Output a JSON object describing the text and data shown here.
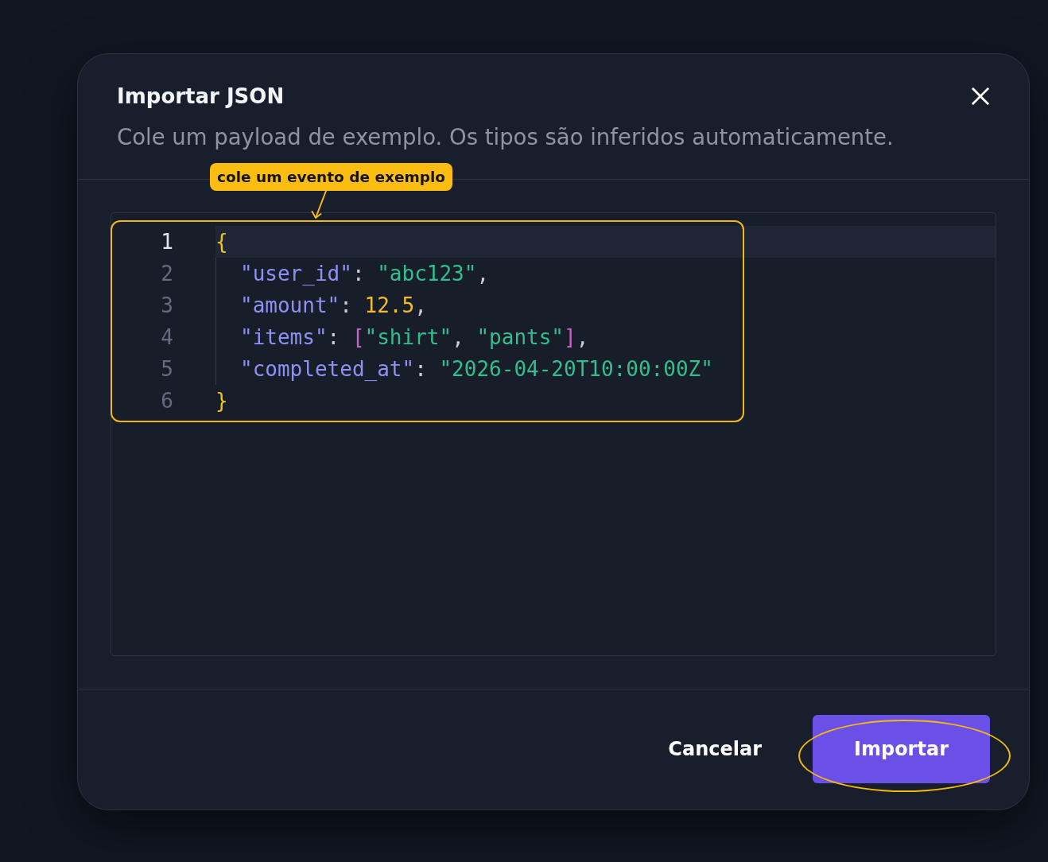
{
  "dialog": {
    "title": "Importar JSON",
    "subtitle": "Cole um payload de exemplo. Os tipos são inferidos automaticamente."
  },
  "editor": {
    "lines": [
      {
        "number": "1",
        "current": true,
        "tokens": [
          {
            "kind": "brace",
            "text": "{"
          }
        ],
        "children": [
          {
            "number": "2",
            "current": false,
            "tokens": [
              {
                "kind": "key",
                "text": "\"user_id\""
              },
              {
                "kind": "punct",
                "text": ": "
              },
              {
                "kind": "string",
                "text": "\"abc123\""
              },
              {
                "kind": "punct",
                "text": ","
              }
            ]
          },
          {
            "number": "3",
            "current": false,
            "tokens": [
              {
                "kind": "key",
                "text": "\"amount\""
              },
              {
                "kind": "punct",
                "text": ": "
              },
              {
                "kind": "number",
                "text": "12.5"
              },
              {
                "kind": "punct",
                "text": ","
              }
            ]
          },
          {
            "number": "4",
            "current": false,
            "tokens": [
              {
                "kind": "key",
                "text": "\"items\""
              },
              {
                "kind": "punct",
                "text": ": "
              },
              {
                "kind": "bracket",
                "text": "["
              },
              {
                "kind": "string",
                "text": "\"shirt\""
              },
              {
                "kind": "punct",
                "text": ", "
              },
              {
                "kind": "string",
                "text": "\"pants\""
              },
              {
                "kind": "bracket",
                "text": "]"
              },
              {
                "kind": "punct",
                "text": ","
              }
            ]
          },
          {
            "number": "5",
            "current": false,
            "tokens": [
              {
                "kind": "key",
                "text": "\"completed_at\""
              },
              {
                "kind": "punct",
                "text": ": "
              },
              {
                "kind": "string",
                "text": "\"2026-04-20T10:00:00Z\""
              }
            ]
          }
        ]
      },
      {
        "number": "6",
        "current": false,
        "tokens": [
          {
            "kind": "brace",
            "text": "}"
          }
        ]
      }
    ]
  },
  "buttons": [
    {
      "kind": "secondary",
      "label": "Cancelar"
    },
    {
      "kind": "primary",
      "label": "Importar"
    }
  ],
  "annotations": [
    {
      "kind": "callout",
      "text": "cole um evento de exemplo"
    },
    {
      "kind": "arrow"
    },
    {
      "kind": "box"
    },
    {
      "kind": "ellipse"
    }
  ]
}
